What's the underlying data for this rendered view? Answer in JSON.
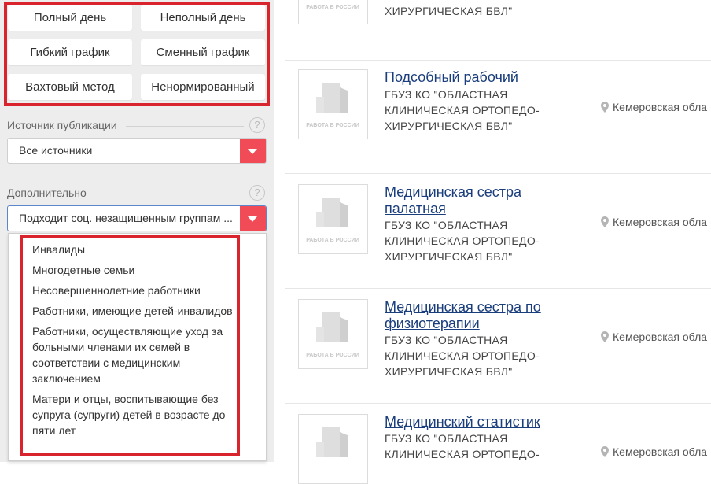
{
  "filters": {
    "schedule_buttons": [
      "Полный день",
      "Неполный день",
      "Гибкий график",
      "Сменный график",
      "Вахтовый метод",
      "Ненормированный"
    ],
    "source": {
      "label": "Источник публикации",
      "help": "?",
      "value": "Все источники"
    },
    "extra": {
      "label": "Дополнительно",
      "help": "?",
      "value": "Подходит соц. незащищенным группам ...",
      "options": [
        "Инвалиды",
        "Многодетные семьи",
        "Несовершеннолетние работники",
        "Работники, имеющие детей-инвалидов",
        "Работники, осуществляющие уход за больными членами их семей в соответствии с медицинским заключением",
        "Матери и отцы, воспитывающие без супруга (супруги) детей в возрасте до пяти лет"
      ]
    }
  },
  "thumb_caption": "РАБОТА В РОССИИ",
  "listings": [
    {
      "title": "",
      "employer": "ХИРУРГИЧЕСКАЯ БВЛ\"",
      "location": ""
    },
    {
      "title": "Подсобный рабочий",
      "employer": "ГБУЗ КО \"ОБЛАСТНАЯ КЛИНИЧЕСКАЯ ОРТОПЕДО-ХИРУРГИЧЕСКАЯ БВЛ\"",
      "location": "Кемеровская обла"
    },
    {
      "title": "Медицинская сестра палатная",
      "employer": "ГБУЗ КО \"ОБЛАСТНАЯ КЛИНИЧЕСКАЯ ОРТОПЕДО-ХИРУРГИЧЕСКАЯ БВЛ\"",
      "location": "Кемеровская обла"
    },
    {
      "title": "Медицинская сестра по физиотерапии",
      "employer": "ГБУЗ КО \"ОБЛАСТНАЯ КЛИНИЧЕСКАЯ ОРТОПЕДО-ХИРУРГИЧЕСКАЯ БВЛ\"",
      "location": "Кемеровская обла"
    },
    {
      "title": "Медицинский статистик",
      "employer": "ГБУЗ КО \"ОБЛАСТНАЯ КЛИНИЧЕСКАЯ ОРТОПЕДО-",
      "location": "Кемеровская обла"
    }
  ],
  "colors": {
    "accent_red": "#f14b57",
    "highlight_frame": "#d9232d",
    "link_blue": "#1a3d7c"
  }
}
